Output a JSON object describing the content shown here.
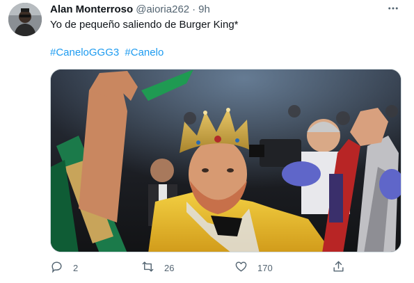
{
  "tweet": {
    "author_name": "Alan Monterroso",
    "author_handle": "@aioria262",
    "separator": "·",
    "time": "9h",
    "text": "Yo de pequeño saliendo de Burger King*",
    "hashtags": [
      "#CaneloGGG3",
      "#Canelo"
    ]
  },
  "actions": {
    "reply_count": "2",
    "retweet_count": "26",
    "like_count": "170"
  },
  "colors": {
    "link": "#1d9bf0",
    "muted": "#536471",
    "text": "#0f1419"
  },
  "icons": {
    "more": "more-dots-icon",
    "reply": "reply-bubble-icon",
    "retweet": "retweet-icon",
    "like": "heart-icon",
    "share": "share-icon"
  }
}
